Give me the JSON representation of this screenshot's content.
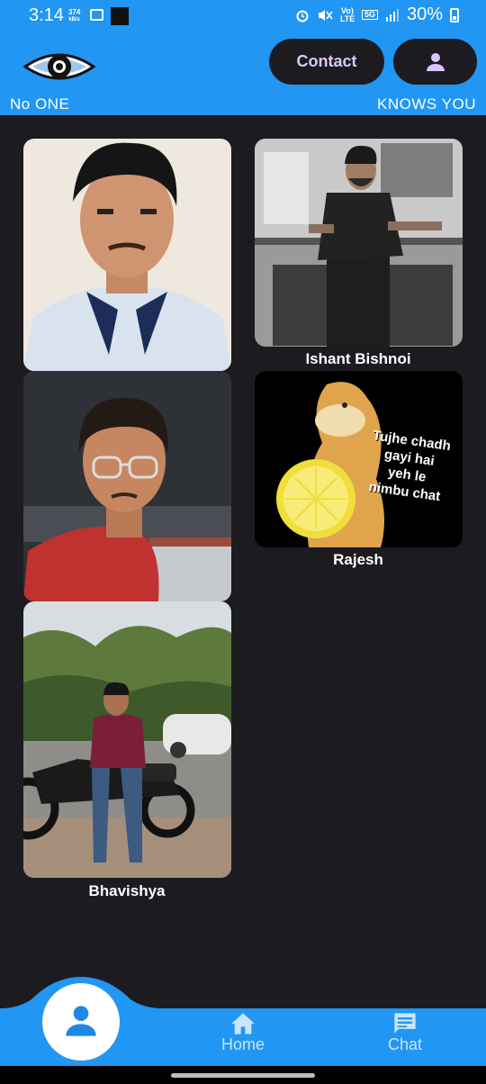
{
  "status_bar": {
    "time": "3:14",
    "speed_value": "374",
    "speed_unit": "kB/s",
    "lte_label": "Vo) LTE",
    "network_label": "5G",
    "battery": "30%"
  },
  "header": {
    "tagline_left": "No ONE",
    "tagline_right": "KNOWS YOU",
    "contact_label": "Contact"
  },
  "profiles": [
    {
      "name": ""
    },
    {
      "name": "Ishant Bishnoi"
    },
    {
      "name": ""
    },
    {
      "name": "Rajesh",
      "meme_text": [
        "Tujhe chadh",
        "gayi hai",
        "yeh le",
        "nimbu chat"
      ]
    },
    {
      "name": "Bhavishya"
    }
  ],
  "bottom_nav": {
    "home_label": "Home",
    "chat_label": "Chat"
  },
  "colors": {
    "primary": "#2196f3",
    "background": "#1c1b20",
    "button_text": "#dcc6ff"
  }
}
